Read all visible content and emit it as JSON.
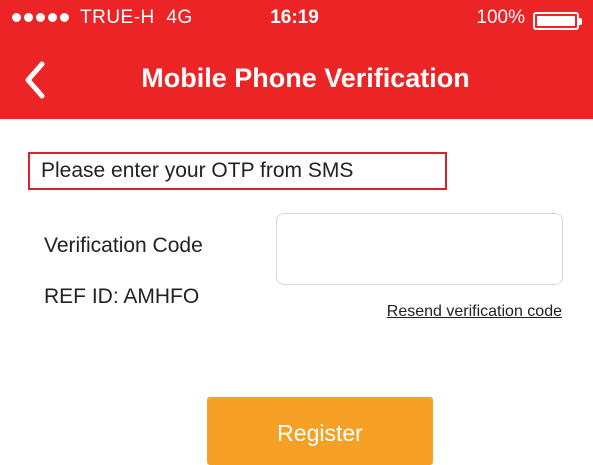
{
  "status_bar": {
    "carrier": "TRUE-H",
    "network": "4G",
    "time": "16:19",
    "battery_percent": "100%",
    "battery_level": 1.0
  },
  "nav": {
    "title": "Mobile Phone Verification",
    "back_icon": "chevron-left-icon"
  },
  "form": {
    "otp_prompt": "Please enter your OTP from SMS",
    "verification_label": "Verification Code",
    "ref_id": "REF ID: AMHFO",
    "code_value": "",
    "code_placeholder": "",
    "resend_label": "Resend verification code",
    "register_label": "Register"
  },
  "colors": {
    "header_bg": "#ec2426",
    "highlight_border": "#dd1f2b",
    "register_bg": "#f6a025"
  }
}
